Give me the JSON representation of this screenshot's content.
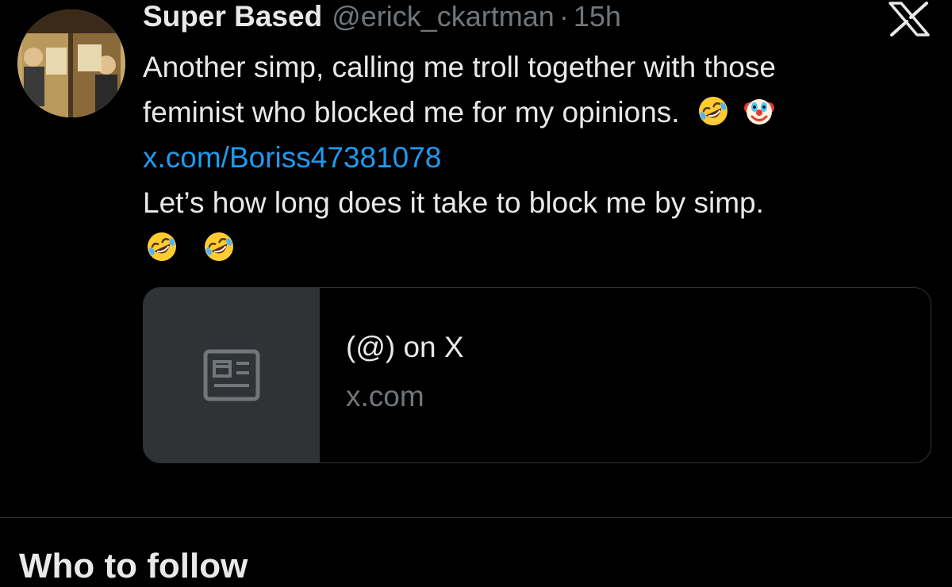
{
  "tweet": {
    "author_name": "Super Based",
    "handle": "@erick_ckartman",
    "separator": "·",
    "time": "15h",
    "text_lines": [
      "Another simp, calling me troll together with those",
      "feminist who blocked me for my opinions."
    ],
    "link_text": "x.com/Boriss47381078",
    "text_line_after_link": "Let’s how long does it take to block me by simp.",
    "emojis_line2": [
      "rolling-on-floor-laughing",
      "clown-face"
    ],
    "emojis_last_line": [
      "rolling-on-floor-laughing",
      "rolling-on-floor-laughing"
    ]
  },
  "card": {
    "title": "(@) on X",
    "domain": "x.com",
    "thumbnail_icon": "article-icon"
  },
  "app": {
    "logo_icon": "x-logo-icon"
  },
  "section": {
    "heading": "Who to follow"
  },
  "colors": {
    "background": "#000000",
    "text": "#e7e9ea",
    "muted": "#71767b",
    "link": "#1d9bf0",
    "card_border": "#2f3336",
    "card_thumb_bg": "#2f3336"
  }
}
